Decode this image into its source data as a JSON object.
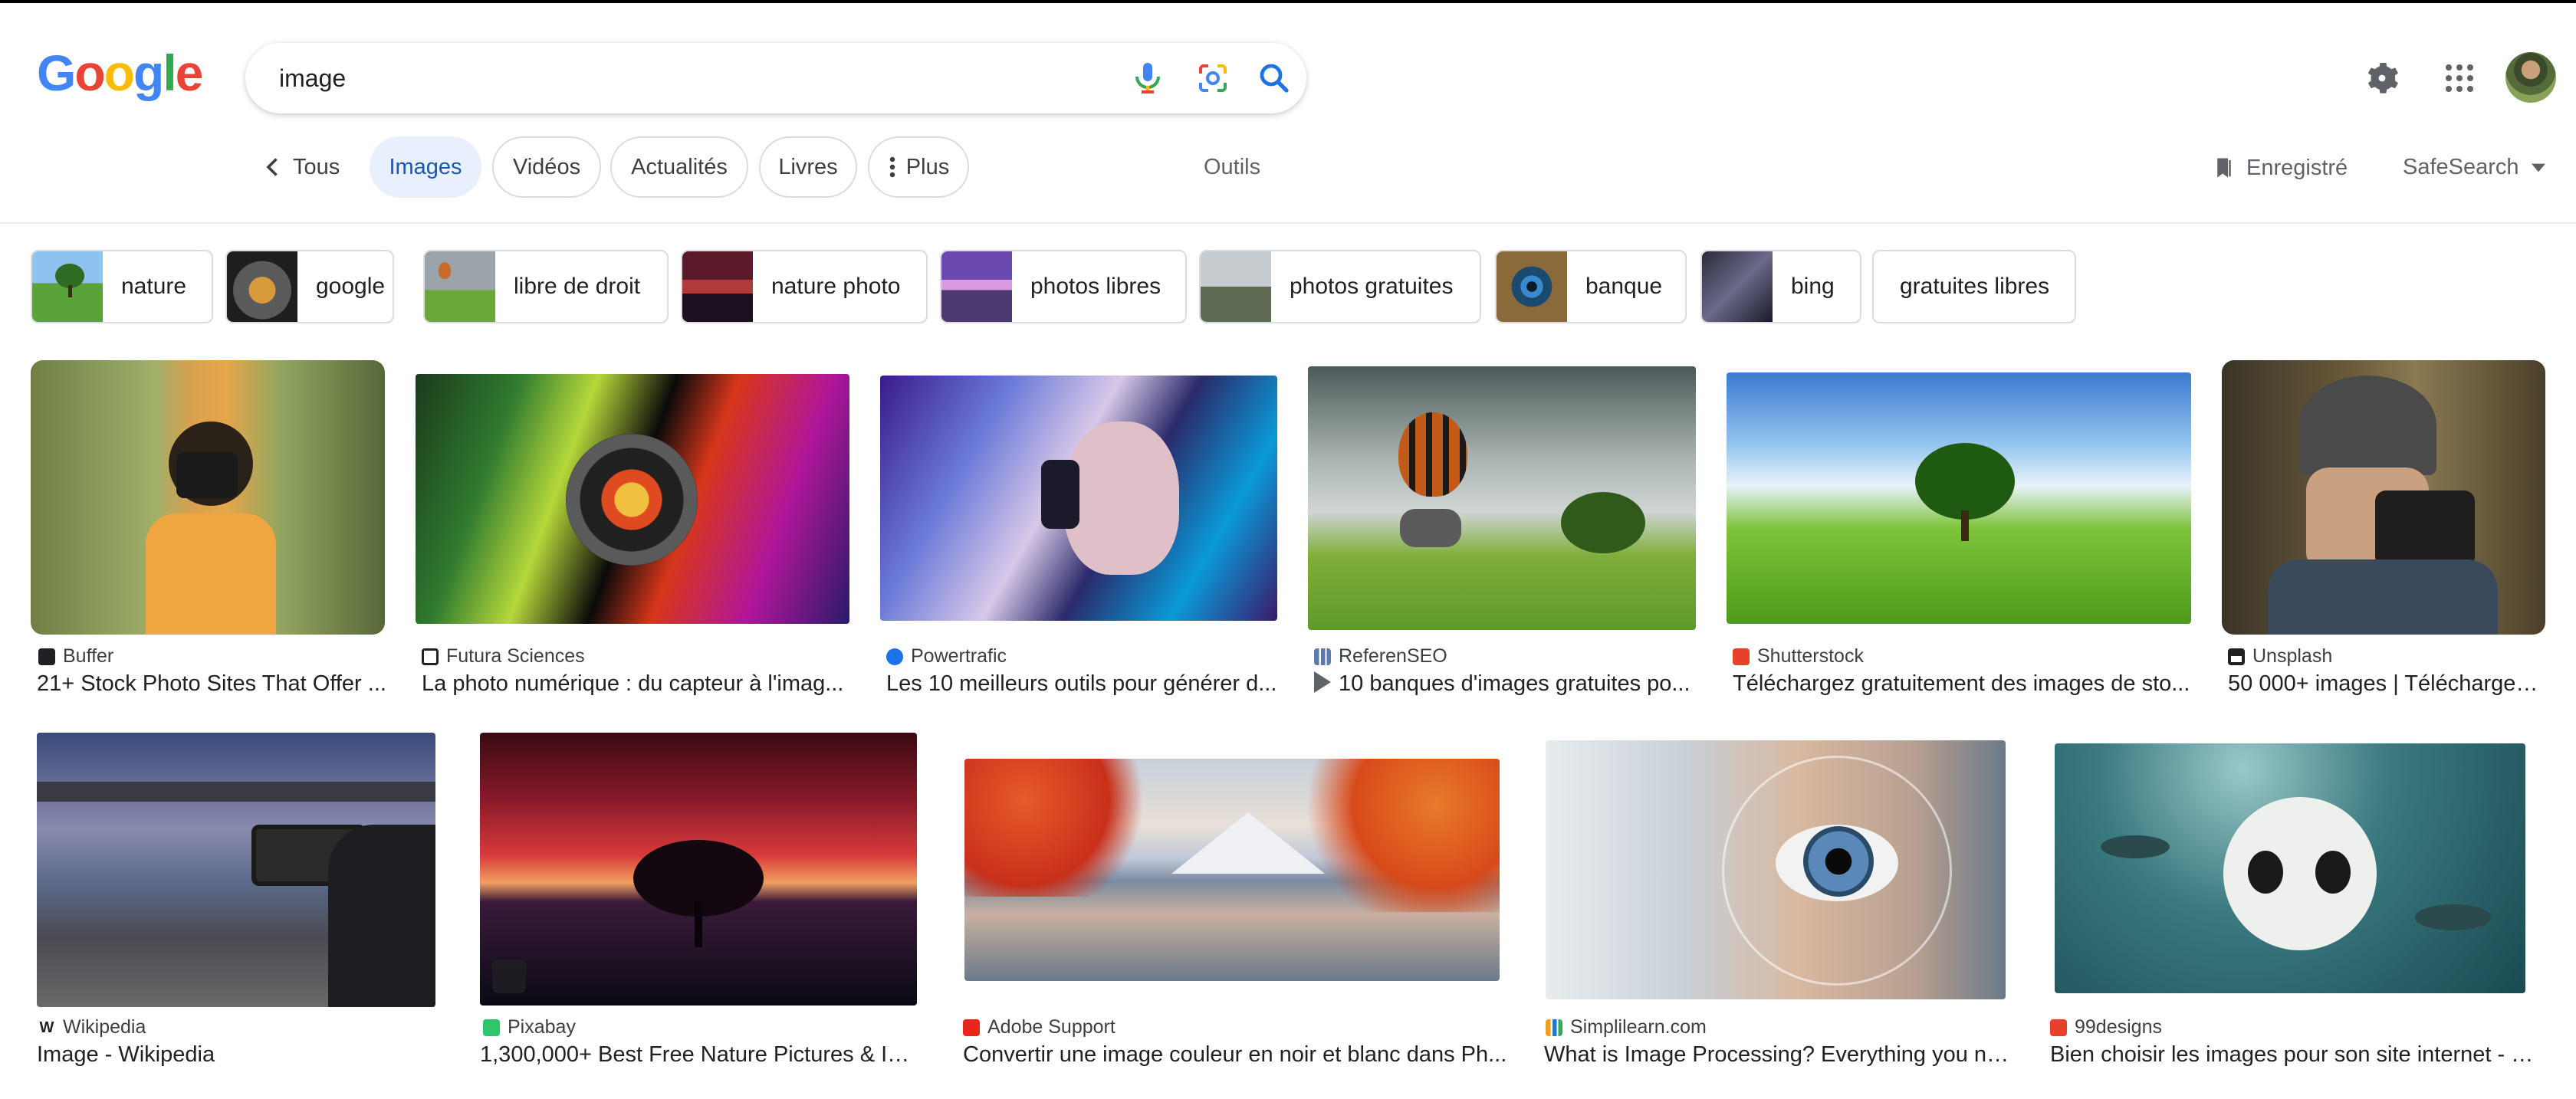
{
  "logo": {
    "letters": [
      "G",
      "o",
      "o",
      "g",
      "l",
      "e"
    ],
    "colors": [
      "#4285F4",
      "#EA4335",
      "#FBBC05",
      "#4285F4",
      "#34A853",
      "#EA4335"
    ]
  },
  "search": {
    "value": "image",
    "placeholder": ""
  },
  "header_icons": [
    "microphone-icon",
    "lens-icon",
    "search-icon",
    "gear-icon",
    "apps-grid-icon",
    "avatar"
  ],
  "tabs": {
    "back_label": "Tous",
    "items": [
      {
        "label": "Images",
        "active": true
      },
      {
        "label": "Vidéos"
      },
      {
        "label": "Actualités"
      },
      {
        "label": "Livres"
      },
      {
        "label": "Plus"
      }
    ],
    "tools": "Outils",
    "saved": "Enregistré",
    "safesearch": "SafeSearch"
  },
  "chips": [
    {
      "label": "nature"
    },
    {
      "label": "google"
    },
    {
      "label": "libre de droit"
    },
    {
      "label": "nature photo"
    },
    {
      "label": "photos libres"
    },
    {
      "label": "photos gratuites"
    },
    {
      "label": "banque"
    },
    {
      "label": "bing"
    },
    {
      "label": "gratuites libres"
    }
  ],
  "results_row1": [
    {
      "source": "Buffer",
      "title": "21+ Stock Photo Sites That Offer ..."
    },
    {
      "source": "Futura Sciences",
      "title": "La photo numérique : du capteur à l'imag..."
    },
    {
      "source": "Powertrafic",
      "title": "Les 10 meilleurs outils pour générer d..."
    },
    {
      "source": "ReferenSEO",
      "title": "10 banques d'images gratuites po..."
    },
    {
      "source": "Shutterstock",
      "title": "Téléchargez gratuitement des images de sto..."
    },
    {
      "source": "Unsplash",
      "title": "50 000+ images | Télécharger ..."
    }
  ],
  "results_row2": [
    {
      "source": "Wikipedia",
      "title": "Image - Wikipedia"
    },
    {
      "source": "Pixabay",
      "title": "1,300,000+ Best Free Nature Pictures & Im..."
    },
    {
      "source": "Adobe Support",
      "title": "Convertir une image couleur en noir et blanc dans Ph..."
    },
    {
      "source": "Simplilearn.com",
      "title": "What is Image Processing? Everything you ne..."
    },
    {
      "source": "99designs",
      "title": "Bien choisir les images pour son site internet - 9..."
    }
  ],
  "colors": {
    "accent": "#1a73e8",
    "active_tab_bg": "#e8f0fe"
  }
}
